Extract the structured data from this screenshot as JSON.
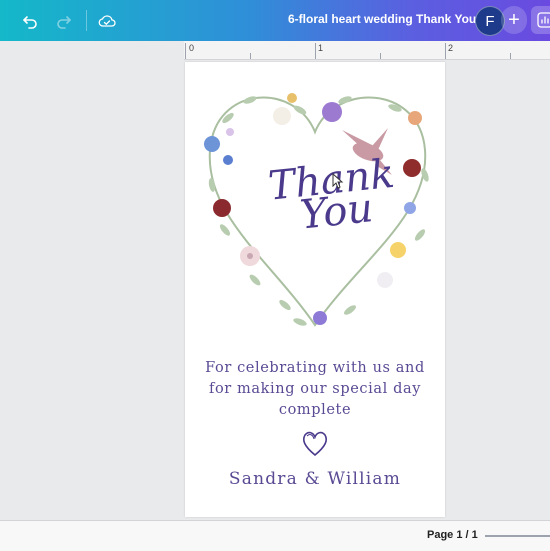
{
  "header": {
    "document_title": "6-floral heart wedding  Thank You",
    "avatar_initial": "F",
    "add_label": "+",
    "undo_icon": "undo-icon",
    "redo_icon": "redo-icon",
    "save_status_icon": "cloud-check-icon"
  },
  "ruler": {
    "marks": [
      "0",
      "1",
      "2"
    ]
  },
  "card": {
    "heading_line1": "Thank",
    "heading_line2": "You",
    "message_line1": "For celebrating with us and",
    "message_line2": "for making our special day",
    "message_line3": "complete",
    "names": "Sandra & William",
    "accent_color": "#4b3a8c"
  },
  "footer": {
    "page_indicator": "Page 1 / 1"
  }
}
